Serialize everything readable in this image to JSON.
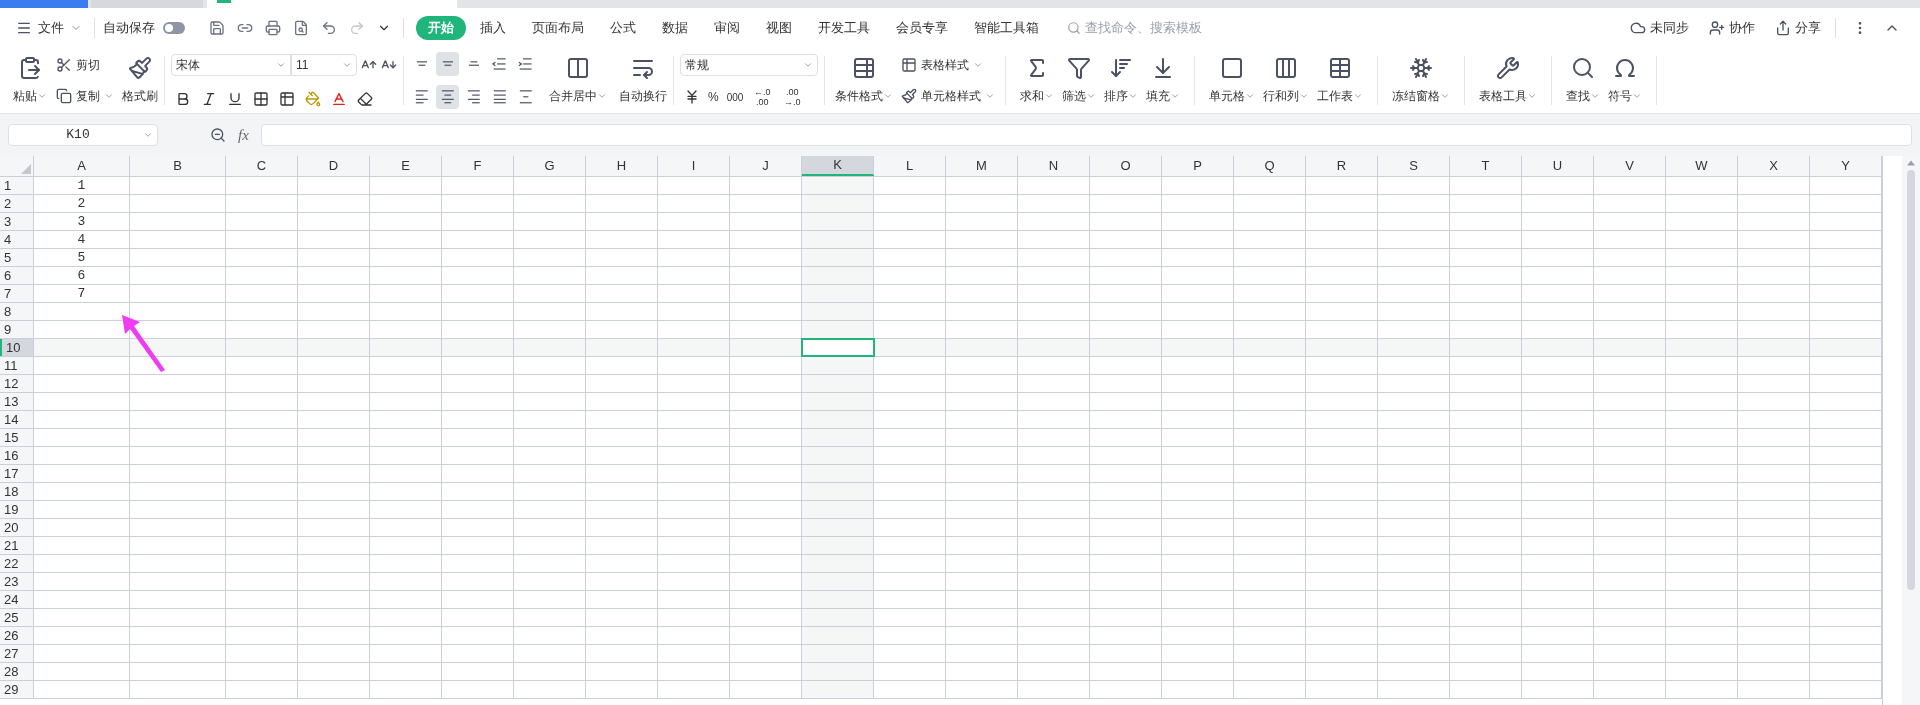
{
  "menu": {
    "file": "文件",
    "autosave": {
      "label": "自动保存",
      "on": false
    },
    "tabs": [
      {
        "label": "开始",
        "selected": true
      },
      {
        "label": "插入",
        "selected": false
      },
      {
        "label": "页面布局",
        "selected": false
      },
      {
        "label": "公式",
        "selected": false
      },
      {
        "label": "数据",
        "selected": false
      },
      {
        "label": "审阅",
        "selected": false
      },
      {
        "label": "视图",
        "selected": false
      },
      {
        "label": "开发工具",
        "selected": false
      },
      {
        "label": "会员专享",
        "selected": false
      },
      {
        "label": "智能工具箱",
        "selected": false
      }
    ],
    "search": {
      "placeholder": "查找命令、搜索模板"
    },
    "actions": [
      {
        "kind": "sync",
        "label": "未同步"
      },
      {
        "kind": "collab",
        "label": "协作"
      },
      {
        "kind": "share",
        "label": "分享"
      }
    ]
  },
  "ribbon": {
    "clipboard": {
      "paste": "粘贴",
      "cut": "剪切",
      "copy": "复制",
      "format_painter": "格式刷"
    },
    "font": {
      "name": "宋体",
      "size": "11"
    },
    "align_top": [
      {
        "kind": "top",
        "selected": false
      },
      {
        "kind": "middle",
        "selected": true
      },
      {
        "kind": "bottom",
        "selected": false
      },
      {
        "kind": "outdent",
        "selected": false
      },
      {
        "kind": "indent",
        "selected": false
      }
    ],
    "align_bottom": [
      {
        "kind": "left",
        "selected": false
      },
      {
        "kind": "center",
        "selected": true
      },
      {
        "kind": "right",
        "selected": false
      },
      {
        "kind": "justify",
        "selected": false
      },
      {
        "kind": "distributed",
        "selected": false
      }
    ],
    "merge": "合并居中",
    "wrap": "自动换行",
    "number": {
      "format": "常规",
      "percent": "%",
      "thousands": "000",
      "increase": "←.0 .00",
      "decrease": ".00 →.0"
    },
    "styles": {
      "conditional": "条件格式",
      "table_style": "表格样式",
      "cell_style": "单元格样式"
    },
    "tool_groups": [
      {
        "items": [
          {
            "kind": "sum",
            "label": "求和"
          },
          {
            "kind": "filter",
            "label": "筛选"
          },
          {
            "kind": "sort",
            "label": "排序"
          },
          {
            "kind": "fill",
            "label": "填充"
          }
        ]
      },
      {
        "items": [
          {
            "kind": "cell",
            "label": "单元格"
          },
          {
            "kind": "rowcol",
            "label": "行和列"
          },
          {
            "kind": "sheet",
            "label": "工作表"
          }
        ]
      },
      {
        "items": [
          {
            "kind": "freeze",
            "label": "冻结窗格"
          }
        ]
      },
      {
        "items": [
          {
            "kind": "tabletools",
            "label": "表格工具"
          }
        ]
      },
      {
        "items": [
          {
            "kind": "find",
            "label": "查找"
          },
          {
            "kind": "symbol",
            "label": "符号"
          }
        ]
      }
    ]
  },
  "formula_bar": {
    "cell_ref": "K10",
    "fx": "fx"
  },
  "sheet": {
    "columns": [
      {
        "label": "A",
        "selected": false
      },
      {
        "label": "B",
        "selected": false
      },
      {
        "label": "C",
        "selected": false
      },
      {
        "label": "D",
        "selected": false
      },
      {
        "label": "E",
        "selected": false
      },
      {
        "label": "F",
        "selected": false
      },
      {
        "label": "G",
        "selected": false
      },
      {
        "label": "H",
        "selected": false
      },
      {
        "label": "I",
        "selected": false
      },
      {
        "label": "J",
        "selected": false
      },
      {
        "label": "K",
        "selected": true
      },
      {
        "label": "L",
        "selected": false
      },
      {
        "label": "M",
        "selected": false
      },
      {
        "label": "N",
        "selected": false
      },
      {
        "label": "O",
        "selected": false
      },
      {
        "label": "P",
        "selected": false
      },
      {
        "label": "Q",
        "selected": false
      },
      {
        "label": "R",
        "selected": false
      },
      {
        "label": "S",
        "selected": false
      },
      {
        "label": "T",
        "selected": false
      },
      {
        "label": "U",
        "selected": false
      },
      {
        "label": "V",
        "selected": false
      },
      {
        "label": "W",
        "selected": false
      },
      {
        "label": "X",
        "selected": false
      },
      {
        "label": "Y",
        "selected": false
      }
    ],
    "rows": [
      {
        "label": "1",
        "selected": false,
        "cells": [
          "1"
        ]
      },
      {
        "label": "2",
        "selected": false,
        "cells": [
          "2"
        ]
      },
      {
        "label": "3",
        "selected": false,
        "cells": [
          "3"
        ]
      },
      {
        "label": "4",
        "selected": false,
        "cells": [
          "4"
        ]
      },
      {
        "label": "5",
        "selected": false,
        "cells": [
          "5"
        ]
      },
      {
        "label": "6",
        "selected": false,
        "cells": [
          "6"
        ]
      },
      {
        "label": "7",
        "selected": false,
        "cells": [
          "7"
        ]
      },
      {
        "label": "8",
        "selected": false
      },
      {
        "label": "9",
        "selected": false
      },
      {
        "label": "10",
        "selected": true
      },
      {
        "label": "11",
        "selected": false
      },
      {
        "label": "12",
        "selected": false
      },
      {
        "label": "13",
        "selected": false
      },
      {
        "label": "14",
        "selected": false
      },
      {
        "label": "15",
        "selected": false
      },
      {
        "label": "16",
        "selected": false
      },
      {
        "label": "17",
        "selected": false
      },
      {
        "label": "18",
        "selected": false
      },
      {
        "label": "19",
        "selected": false
      },
      {
        "label": "20",
        "selected": false
      },
      {
        "label": "21",
        "selected": false
      },
      {
        "label": "22",
        "selected": false
      },
      {
        "label": "23",
        "selected": false
      },
      {
        "label": "24",
        "selected": false
      },
      {
        "label": "25",
        "selected": false
      },
      {
        "label": "26",
        "selected": false
      },
      {
        "label": "27",
        "selected": false
      },
      {
        "label": "28",
        "selected": false
      },
      {
        "label": "29",
        "selected": false
      }
    ]
  }
}
